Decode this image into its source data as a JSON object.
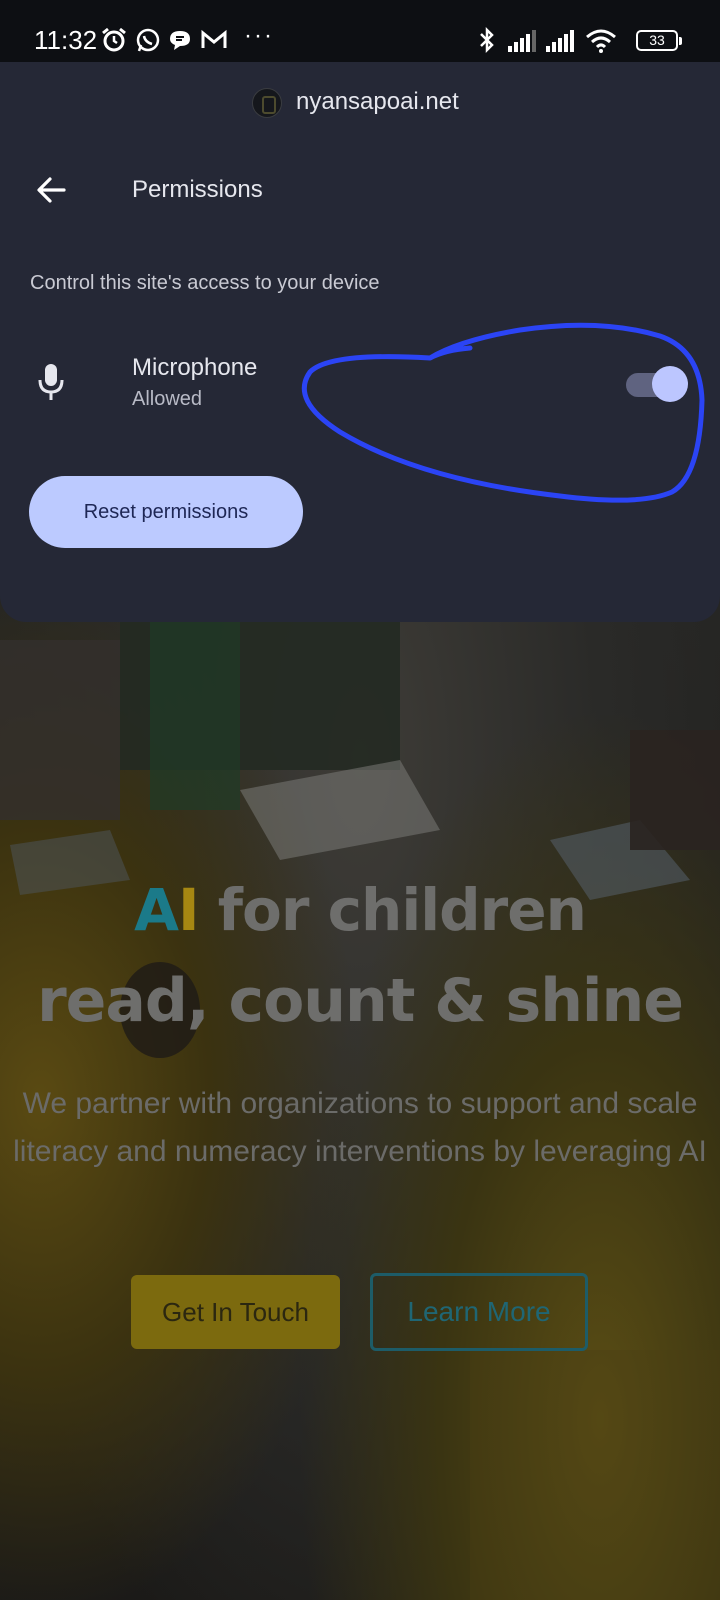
{
  "status_bar": {
    "time": "11:32",
    "battery": "33",
    "dots": "···",
    "icons": [
      "alarm-icon",
      "whatsapp-icon",
      "chat-bubble-icon",
      "gmail-icon",
      "bluetooth-icon",
      "signal-icon",
      "signal-icon",
      "wifi-icon",
      "battery-icon"
    ]
  },
  "sheet": {
    "origin": "nyansapoai.net",
    "title": "Permissions",
    "subtitle": "Control this site's access to your device",
    "permission": {
      "name": "Microphone",
      "status": "Allowed",
      "icon": "microphone-icon",
      "toggle_on": true
    },
    "reset_label": "Reset permissions"
  },
  "website": {
    "title_ai_a": "A",
    "title_ai_i": "I",
    "title_rest": " for children",
    "title_line2": "read, count & shine",
    "description": "We partner with organizations to support and scale literacy and numeracy interventions by leveraging AI",
    "button_primary": "Get In Touch",
    "button_secondary": "Learn More"
  },
  "colors": {
    "sheet_bg": "#252836",
    "accent": "#bccaff",
    "annotation": "#2b44f5",
    "ai_a": "#1b7a89",
    "ai_i": "#a68712"
  }
}
